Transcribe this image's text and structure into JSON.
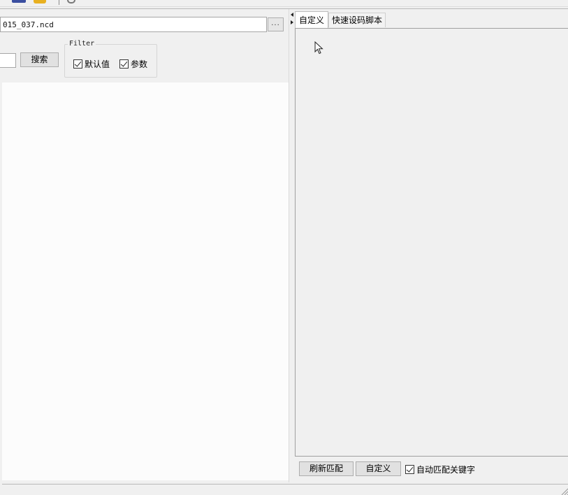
{
  "toolbar": {
    "icons": [
      "grid-icon",
      "folder-icon",
      "refresh-icon"
    ]
  },
  "left_panel": {
    "file_path": "015_037.ncd",
    "browse_label": "...",
    "search_value": "",
    "search_button": "搜索",
    "filter": {
      "legend": "Filter",
      "default_value_label": "默认值",
      "default_value_checked": true,
      "params_label": "参数",
      "params_checked": true
    }
  },
  "right_panel": {
    "tabs": [
      {
        "label": "自定义",
        "active": true
      },
      {
        "label": "快速设码脚本",
        "active": false
      }
    ],
    "refresh_match_button": "刷新匹配",
    "custom_button": "自定义",
    "auto_match_label": "自动匹配关键字",
    "auto_match_checked": true
  },
  "colors": {
    "window_bg": "#f0f0f0",
    "content_bg": "#fcfcfc",
    "button_bg": "#e1e1e1"
  }
}
